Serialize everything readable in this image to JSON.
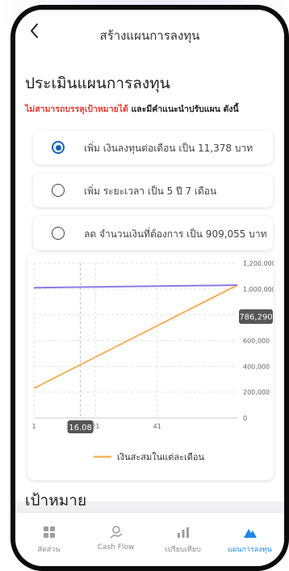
{
  "header": {
    "title": "สร้างแผนการลงทุน"
  },
  "section": {
    "title": "ประเมินแผนการลงทุน",
    "warning_red": "ไม่สามารถบรรลุเป้าหมายได้",
    "warning_rest": " และมีคำแนะนำปรับแผน ดังนี้"
  },
  "options": [
    {
      "label": "เพิ่ม เงินลงทุนต่อเดือน เป็น 11,378 บาท",
      "selected": true
    },
    {
      "label": "เพิ่ม ระยะเวลา เป็น 5 ปี 7 เดือน",
      "selected": false
    },
    {
      "label": "ลด จำนวนเงินที่ต้องการ เป็น 909,055 บาท",
      "selected": false
    }
  ],
  "chart_data": {
    "type": "line",
    "x_tick_labels": [
      "1",
      "21",
      "41"
    ],
    "y_tick_labels": [
      "0",
      "200,000",
      "400,000",
      "600,000",
      "800,000",
      "1,000,000",
      "1,200,000"
    ],
    "ylim": [
      0,
      1200000
    ],
    "xlim": [
      1,
      67
    ],
    "y_axis_position": "right",
    "series": [
      {
        "name": "เงินสะสมในแต่ละเดือน",
        "color": "#f7b15c",
        "x": [
          1,
          67
        ],
        "y": [
          230000,
          1030000
        ]
      },
      {
        "color": "#8c7ae6",
        "x": [
          1,
          67
        ],
        "y": [
          1010000,
          1030000
        ]
      }
    ],
    "tooltip_y": "786,290",
    "tooltip_x": "16.08",
    "legend_position": "bottom"
  },
  "goal": {
    "title": "เป้าหมาย"
  },
  "nav": [
    {
      "label": "สัดส่วน",
      "icon": "grid-icon",
      "active": false
    },
    {
      "label": "Cash Flow",
      "icon": "cashflow-icon",
      "active": false
    },
    {
      "label": "เปรียบเทียบ",
      "icon": "compare-chart-icon",
      "active": false
    },
    {
      "label": "แผนการลงทุน",
      "icon": "mountain-icon",
      "active": true
    }
  ],
  "colors": {
    "accent": "#1e88e5",
    "warning": "#e53935",
    "line_orange": "#f7b15c",
    "line_purple": "#8c7ae6"
  }
}
